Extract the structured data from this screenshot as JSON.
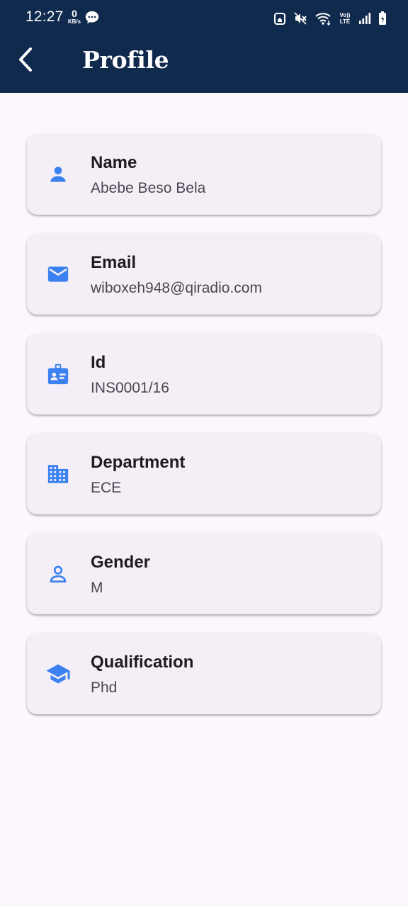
{
  "status_bar": {
    "time": "12:27",
    "net_speed_value": "0",
    "net_speed_unit": "KB/s",
    "volte_line1": "Vo))",
    "volte_line2": "LTE"
  },
  "app_bar": {
    "title": "Profile",
    "back_icon": "arrow-back-icon"
  },
  "colors": {
    "header_bg": "#102a4e",
    "page_bg": "#fcf7fd",
    "card_bg": "#f4eff6",
    "icon_accent": "#3b82f0"
  },
  "profile": {
    "fields": [
      {
        "label": "Name",
        "value": "Abebe Beso Bela",
        "icon": "person-icon"
      },
      {
        "label": "Email",
        "value": "wiboxeh948@qiradio.com",
        "icon": "email-icon"
      },
      {
        "label": "Id",
        "value": "INS0001/16",
        "icon": "badge-icon"
      },
      {
        "label": "Department",
        "value": "ECE",
        "icon": "building-icon"
      },
      {
        "label": "Gender",
        "value": "M",
        "icon": "person-outline-icon"
      },
      {
        "label": "Qualification",
        "value": "Phd",
        "icon": "school-icon"
      }
    ]
  }
}
